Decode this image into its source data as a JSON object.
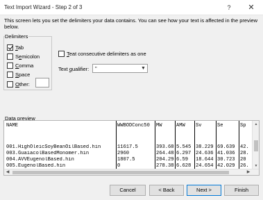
{
  "window": {
    "title": "Text Import Wizard - Step 2 of 3",
    "help": "?",
    "close": "✕"
  },
  "description": "This screen lets you set the delimiters your data contains. You can see how your text is affected in the preview below.",
  "delimiters": {
    "label": "Delimiters",
    "items": [
      {
        "key": "T",
        "rest": "ab",
        "checked": true
      },
      {
        "key": "",
        "pre": "S",
        "keyMid": "e",
        "rest": "micolon",
        "checked": false
      },
      {
        "key": "C",
        "rest": "omma",
        "checked": false
      },
      {
        "key": "S",
        "rest": "pace",
        "checked": false
      },
      {
        "key": "O",
        "rest": "ther:",
        "checked": false
      }
    ],
    "other_value": ""
  },
  "treat_consecutive": {
    "key": "R",
    "pre": "T",
    "label_rest": "eat consecutive delimiters as one",
    "checked": false
  },
  "text_qualifier": {
    "label_pre": "Text ",
    "key": "q",
    "label_rest": "ualifier:",
    "value": "\""
  },
  "preview": {
    "label": "Data preview",
    "columns": [
      "NAME",
      "WWBODConc50",
      "MW",
      "AMW",
      "Sv",
      "Se",
      "Sp"
    ],
    "rows": [
      [
        "001.HighOleicSoyBeanOilBased.hin",
        "11617.5",
        "393.68",
        "5.545",
        "38.229",
        "69.639",
        "42."
      ],
      [
        "003.GuaiacolBasedMonomer.hin",
        "2960",
        "264.48",
        "6.297",
        "24.636",
        "41.036",
        "28."
      ],
      [
        "004.AVVEugenolBased.hin",
        "1807.5",
        "204.29",
        "6.59",
        "18.644",
        "30.723",
        "20"
      ],
      [
        "005.EugenolBased.hin",
        "0",
        "278.38",
        "6.628",
        "24.654",
        "42.029",
        "26."
      ]
    ]
  },
  "buttons": {
    "cancel": "Cancel",
    "back": "< Back",
    "next": "Next >",
    "finish": "Finish"
  }
}
